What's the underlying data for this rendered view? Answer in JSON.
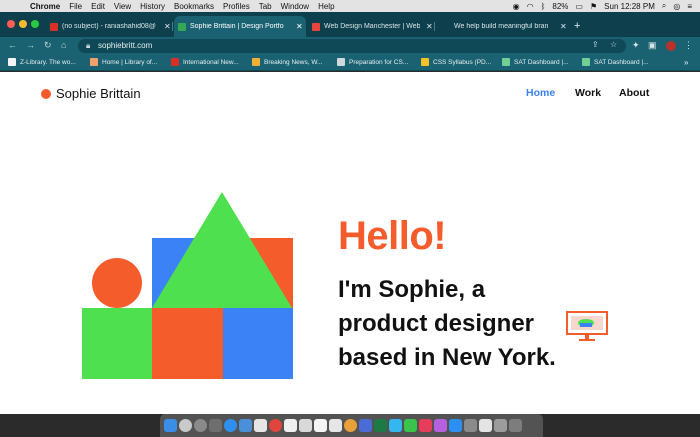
{
  "menubar": {
    "app": "Chrome",
    "items": [
      "File",
      "Edit",
      "View",
      "History",
      "Bookmarks",
      "Profiles",
      "Tab",
      "Window",
      "Help"
    ],
    "battery": "82%",
    "clock": "Sun 12:28 PM"
  },
  "tabs": [
    {
      "title": "(no subject) - raniashahid08@",
      "color": "#d93025"
    },
    {
      "title": "Sophie Brittain | Design Portfo",
      "color": "#34a853"
    },
    {
      "title": "Web Design Manchester | Web",
      "color": "#e8453c"
    },
    {
      "title": "We help build meaningful bran",
      "color": "#1a6272"
    }
  ],
  "url": "sophiebritt.com",
  "bookmarks": [
    {
      "label": "Z-Library. The wo...",
      "color": "#f4f4f4"
    },
    {
      "label": "Home | Library of...",
      "color": "#f2a16b"
    },
    {
      "label": "International New...",
      "color": "#d93025"
    },
    {
      "label": "Breaking News, W...",
      "color": "#f2b134"
    },
    {
      "label": "Preparation for CS...",
      "color": "#cfd8dc"
    },
    {
      "label": "CSS Syllabus (PD...",
      "color": "#f6c026"
    },
    {
      "label": "SAT Dashboard |...",
      "color": "#6fcf97"
    },
    {
      "label": "SAT Dashboard |...",
      "color": "#6fcf97"
    }
  ],
  "site": {
    "brand": "Sophie Brittain",
    "nav": [
      "Home",
      "Work",
      "About"
    ],
    "hello": "Hello!",
    "intro_lines": [
      "I'm Sophie, a",
      "product designer",
      "based in New York."
    ]
  },
  "colors": {
    "accent": "#f45d2b",
    "nav_active": "#3b82f6",
    "shape_green": "#4ee04e",
    "shape_blue": "#3b82f6",
    "shape_orange": "#f45d2b"
  }
}
